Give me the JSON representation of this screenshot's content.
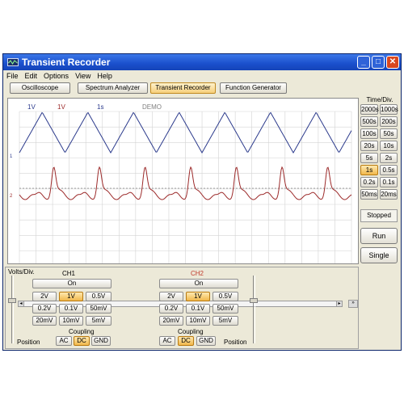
{
  "window": {
    "title": "Transient Recorder",
    "app_icon": "scope-app-icon",
    "minimize": "_",
    "maximize": "□",
    "close": "✕"
  },
  "menu": [
    "File",
    "Edit",
    "Options",
    "View",
    "Help"
  ],
  "tabs": [
    {
      "label": "Oscilloscope",
      "active": false
    },
    {
      "label": "Spectrum Analyzer",
      "active": false
    },
    {
      "label": "Transient Recorder",
      "active": true
    },
    {
      "label": "Function Generator",
      "active": false
    }
  ],
  "scope": {
    "ch1_volts": "1V",
    "ch2_volts": "1V",
    "time": "1s",
    "mode": "DEMO",
    "marker1": "1",
    "marker2": "2",
    "colors": {
      "ch1": "#2b3a8c",
      "ch2": "#9c2a2a",
      "grid": "#d3d3d3"
    },
    "scroll_left": "◂",
    "scroll_right": "▸",
    "scroll_end": "»"
  },
  "time_div": {
    "title": "Time/Div.",
    "buttons": [
      [
        "2000s",
        "1000s"
      ],
      [
        "500s",
        "200s"
      ],
      [
        "100s",
        "50s"
      ],
      [
        "20s",
        "10s"
      ],
      [
        "5s",
        "2s"
      ],
      [
        "1s",
        "0.5s"
      ],
      [
        "0.2s",
        "0.1s"
      ],
      [
        "50ms",
        "20ms"
      ]
    ],
    "active": "1s"
  },
  "status": "Stopped",
  "run_label": "Run",
  "single_label": "Single",
  "volts_div_label": "Volts/Div.",
  "ch1": {
    "label": "CH1",
    "on_label": "On",
    "volts": [
      [
        "2V",
        "1V",
        "0.5V"
      ],
      [
        "0.2V",
        "0.1V",
        "50mV"
      ],
      [
        "20mV",
        "10mV",
        "5mV"
      ]
    ],
    "active_volts": "1V",
    "coupling_label": "Coupling",
    "coupling": [
      "AC",
      "DC",
      "GND"
    ],
    "active_coupling": "DC",
    "position_label": "Position"
  },
  "ch2": {
    "label": "CH2",
    "on_label": "On",
    "volts": [
      [
        "2V",
        "1V",
        "0.5V"
      ],
      [
        "0.2V",
        "0.1V",
        "50mV"
      ],
      [
        "20mV",
        "10mV",
        "5mV"
      ]
    ],
    "active_volts": "1V",
    "coupling_label": "Coupling",
    "coupling": [
      "AC",
      "DC",
      "GND"
    ],
    "active_coupling": "DC",
    "position_label": "Position",
    "color": "#c0392b"
  }
}
